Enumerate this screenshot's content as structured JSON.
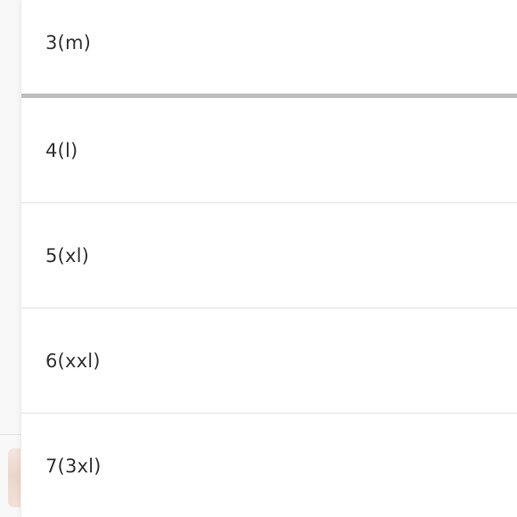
{
  "size_picker": {
    "options": [
      {
        "label": "3(m)",
        "selected": true
      },
      {
        "label": "4(l)",
        "selected": false
      },
      {
        "label": "5(xl)",
        "selected": false
      },
      {
        "label": "6(xxl)",
        "selected": false
      },
      {
        "label": "7(3xl)",
        "selected": false
      }
    ],
    "selected_indicator_color": "#bdbdbd",
    "divider_color": "#e3e3e3",
    "text_color": "#333333"
  }
}
